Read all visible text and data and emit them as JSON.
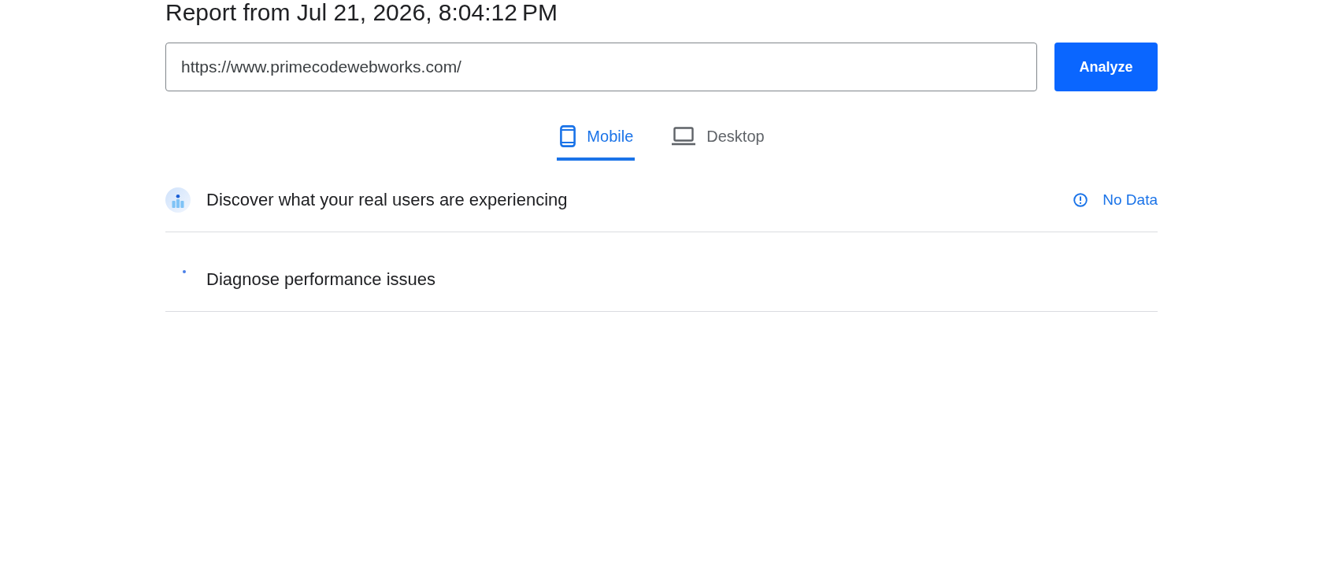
{
  "report_title": "Report from Jul 21, 2026, 8:04:12 PM",
  "url_field": {
    "value": "https://www.primecodewebworks.com/"
  },
  "analyze_button": "Analyze",
  "tabs": [
    {
      "label": "Mobile",
      "kind": "mobile",
      "selected": true
    },
    {
      "label": "Desktop",
      "kind": "desktop",
      "selected": false
    }
  ],
  "sections": [
    {
      "kind": "field_data",
      "title": "Discover what your real users are experiencing",
      "status": "No Data"
    },
    {
      "kind": "lab_data",
      "title": "Diagnose performance issues"
    }
  ]
}
